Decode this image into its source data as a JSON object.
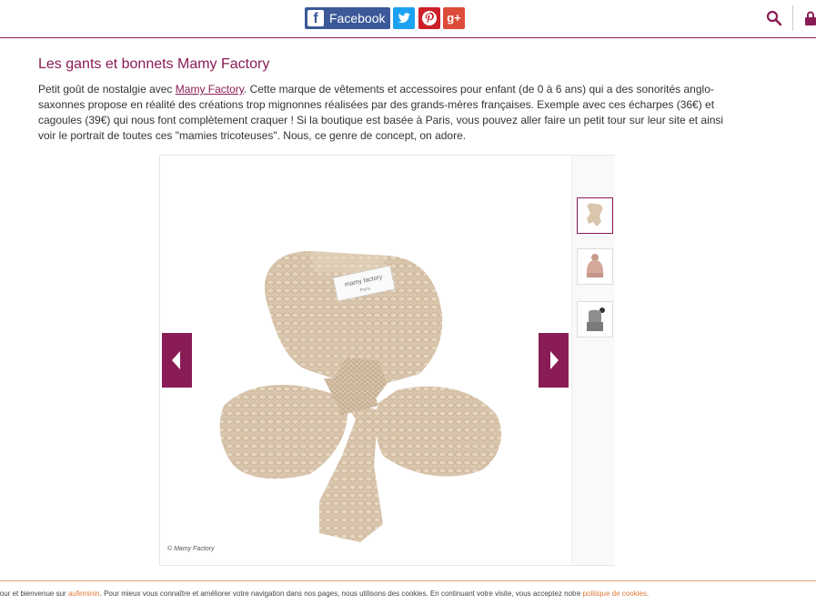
{
  "header": {
    "facebook_label": "Facebook",
    "facebook_icon": "facebook-icon",
    "twitter_icon": "twitter-icon",
    "pinterest_icon": "pinterest-icon",
    "googleplus_icon": "google-plus-icon",
    "search_icon": "search-icon",
    "account_icon": "lock-icon",
    "accent_color": "#8a1c55"
  },
  "article": {
    "title": "Les gants et bonnets Mamy Factory",
    "para_before_link": "Petit goût de nostalgie avec ",
    "link_text": "Mamy Factory",
    "para_after_link": ". Cette marque de vêtements et accessoires pour enfant (de 0 à 6 ans) qui a des sonorités anglo-saxonnes propose en réalité des créations trop mignonnes réalisées par des grands-mères françaises. Exemple avec ces écharpes (36€) et cagoules (39€) qui nous font complètement craquer ! Si la boutique est basée à Paris, vous pouvez aller faire un petit tour sur leur site et ainsi voir le portrait de toutes ces \"mamies tricoteuses\". Nous, ce genre de concept, on adore."
  },
  "gallery": {
    "image_subject": "knitted beige scarf with Mamy Factory label",
    "label_text": "mamy factory",
    "credit": "© Mamy Factory",
    "prev_icon": "chevron-left-icon",
    "next_icon": "chevron-right-icon",
    "thumbnails": [
      {
        "subject": "beige scarf",
        "active": true
      },
      {
        "subject": "pink pompom hat",
        "active": false
      },
      {
        "subject": "grey hat and scarf",
        "active": false
      }
    ]
  },
  "cookie_bar": {
    "before_link": "jour et bienvenue sur ",
    "site_link": "aufeminin",
    "middle": ". Pour mieux vous connaître et améliorer votre navigation dans nos pages, nous utilisons des cookies. En continuant votre visite, vous acceptez notre ",
    "policy_link": "politique de cookies",
    "end": "."
  }
}
